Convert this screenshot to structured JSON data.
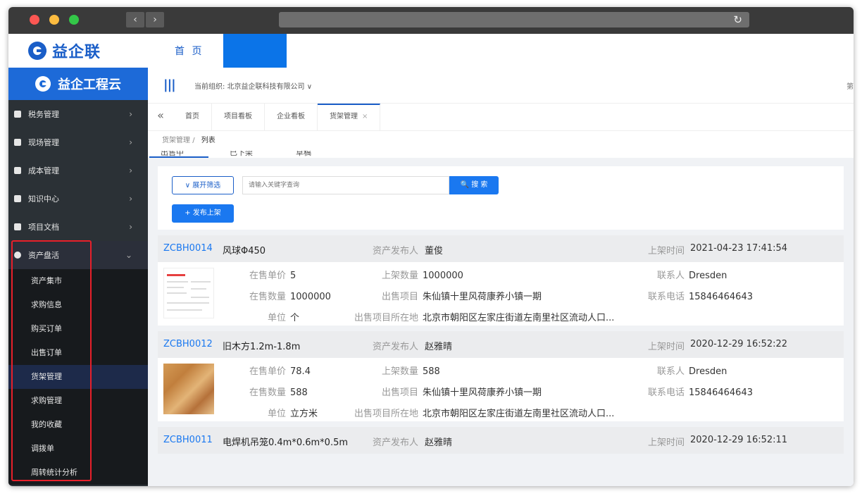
{
  "top": {
    "brand": "益企联",
    "nav_home": "首 页"
  },
  "sidebar": {
    "title": "益企工程云",
    "menu": [
      {
        "label": "税务管理",
        "icon": "ledger-icon"
      },
      {
        "label": "现场管理",
        "icon": "grid-icon"
      },
      {
        "label": "成本管理",
        "icon": "chart-icon"
      },
      {
        "label": "知识中心",
        "icon": "book-icon"
      },
      {
        "label": "项目文档",
        "icon": "cloud-icon"
      }
    ],
    "open_menu": {
      "label": "资产盘活",
      "icon": "circle-icon"
    },
    "submenu": [
      "资产集市",
      "求购信息",
      "购买订单",
      "出售订单",
      "货架管理",
      "求购管理",
      "我的收藏",
      "调拨单",
      "周转统计分析"
    ],
    "active_submenu": "货架管理"
  },
  "header": {
    "org": "当前组织:  北京益企联科技有限公司 ∨",
    "right_text": "第"
  },
  "tabs": [
    "首页",
    "项目看板",
    "企业看板",
    "货架管理"
  ],
  "breadcrumb": {
    "parent": "货架管理",
    "sep": "/",
    "current": "列表"
  },
  "status_tabs": [
    "出售中",
    "已下架",
    "草稿"
  ],
  "toolbar": {
    "expand_label": "∨ 展开筛选",
    "search_placeholder": "请输入关键字查询",
    "search_label": "🔍 搜 索",
    "publish_label": "+ 发布上架"
  },
  "labels": {
    "publisher": "资产发布人",
    "time": "上架时间",
    "unit_price": "在售单价",
    "qty_listed": "上架数量",
    "contact": "联系人",
    "qty_sale": "在售数量",
    "project": "出售项目",
    "phone": "联系电话",
    "unit": "单位",
    "location": "出售项目所在地"
  },
  "items": [
    {
      "code": "ZCBH0014",
      "name": "风球Φ450",
      "publisher": "董俊",
      "time": "2021-04-23 17:41:54",
      "unit_price": "5",
      "qty_listed": "1000000",
      "contact": "Dresden",
      "qty_sale": "1000000",
      "project": "朱仙镇十里风荷康养小镇一期",
      "phone": "15846464643",
      "unit": "个",
      "location": "北京市朝阳区左家庄街道左南里社区流动人口..."
    },
    {
      "code": "ZCBH0012",
      "name": "旧木方1.2m-1.8m",
      "publisher": "赵雅晴",
      "time": "2020-12-29 16:52:22",
      "unit_price": "78.4",
      "qty_listed": "588",
      "contact": "Dresden",
      "qty_sale": "588",
      "project": "朱仙镇十里风荷康养小镇一期",
      "phone": "15846464643",
      "unit": "立方米",
      "location": "北京市朝阳区左家庄街道左南里社区流动人口..."
    },
    {
      "code": "ZCBH0011",
      "name": "电焊机吊笼0.4m*0.6m*0.5m",
      "publisher": "赵雅晴",
      "time": "2020-12-29 16:52:11"
    }
  ]
}
